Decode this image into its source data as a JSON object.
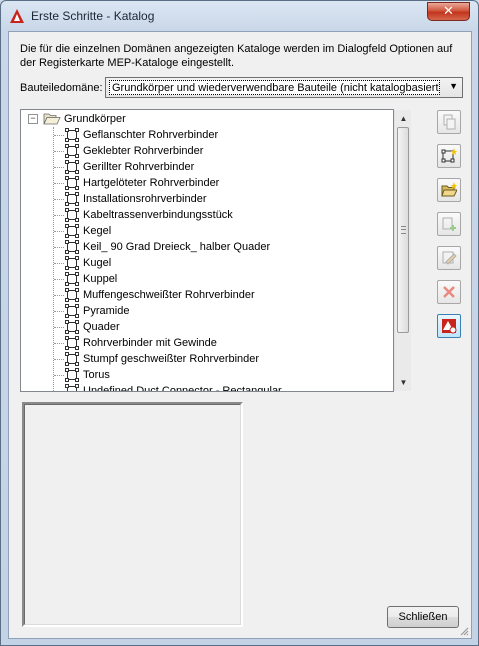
{
  "window": {
    "title": "Erste Schritte - Katalog",
    "close_glyph": "✕"
  },
  "description": "Die für die einzelnen Domänen angezeigten Kataloge werden im Dialogfeld Optionen auf der Registerkarte MEP-Kataloge eingestellt.",
  "domain": {
    "label": "Bauteiledomäne:",
    "value": "Grundkörper und wiederverwendbare Bauteile (nicht katalogbasiert)"
  },
  "tree": {
    "root": {
      "label": "Grundkörper",
      "toggle": "−"
    },
    "items": [
      "Geflanschter Rohrverbinder",
      "Geklebter Rohrverbinder",
      "Gerillter Rohrverbinder",
      "Hartgelöteter Rohrverbinder",
      "Installationsrohrverbinder",
      "Kabeltrassenverbindungsstück",
      "Kegel",
      "Keil_ 90 Grad Dreieck_ halber Quader",
      "Kugel",
      "Kuppel",
      "Muffengeschweißter Rohrverbinder",
      "Pyramide",
      "Quader",
      "Rohrverbinder mit Gewinde",
      "Stumpf geschweißter Rohrverbinder",
      "Torus",
      "Undefined Duct Connector - Rectangular"
    ]
  },
  "toolbar": [
    {
      "icon": "copy-icon",
      "enabled": false
    },
    {
      "icon": "new-part-icon",
      "enabled": true
    },
    {
      "icon": "open-folder-icon",
      "enabled": true
    },
    {
      "icon": "add-size-icon",
      "enabled": false
    },
    {
      "icon": "edit-part-icon",
      "enabled": false
    },
    {
      "icon": "delete-icon",
      "enabled": false
    },
    {
      "icon": "autocad-mep-icon",
      "enabled": true
    }
  ],
  "buttons": {
    "close_label": "Schließen"
  },
  "colors": {
    "accent": "#cc2222",
    "selection_border": "#3c7fb1"
  }
}
